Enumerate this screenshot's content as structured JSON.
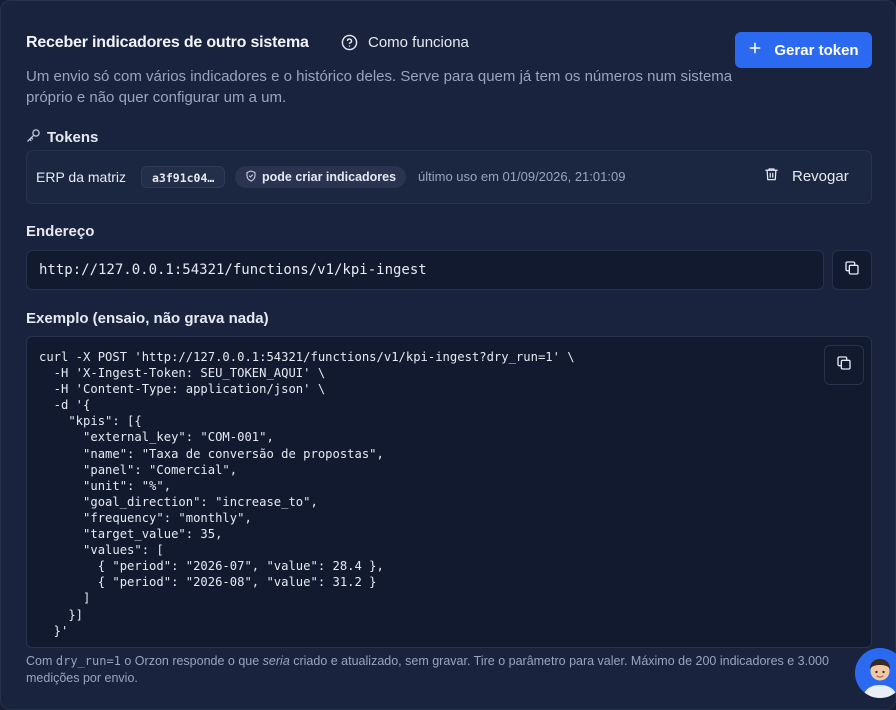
{
  "header": {
    "title": "Receber indicadores de outro sistema",
    "how_it_works": "Como funciona",
    "generate_button": "Gerar token",
    "description": "Um envio só com vários indicadores e o histórico deles. Serve para quem já tem os números num sistema próprio e não quer configurar um a um."
  },
  "tokens": {
    "label": "Tokens",
    "items": [
      {
        "name": "ERP da matriz",
        "code": "a3f91c04…",
        "permission": "pode criar indicadores",
        "last_used": "último uso em 01/09/2026, 21:01:09",
        "revoke_label": "Revogar"
      }
    ]
  },
  "endpoint": {
    "label": "Endereço",
    "url": "http://127.0.0.1:54321/functions/v1/kpi-ingest"
  },
  "example": {
    "label": "Exemplo (ensaio, não grava nada)",
    "code": "curl -X POST 'http://127.0.0.1:54321/functions/v1/kpi-ingest?dry_run=1' \\\n  -H 'X-Ingest-Token: SEU_TOKEN_AQUI' \\\n  -H 'Content-Type: application/json' \\\n  -d '{\n    \"kpis\": [{\n      \"external_key\": \"COM-001\",\n      \"name\": \"Taxa de conversão de propostas\",\n      \"panel\": \"Comercial\",\n      \"unit\": \"%\",\n      \"goal_direction\": \"increase_to\",\n      \"frequency\": \"monthly\",\n      \"target_value\": 35,\n      \"values\": [\n        { \"period\": \"2026-07\", \"value\": 28.4 },\n        { \"period\": \"2026-08\", \"value\": 31.2 }\n      ]\n    }]\n  }'"
  },
  "footer_note": {
    "prefix": "Com ",
    "code": "dry_run=1",
    "middle": " o Orzon responde o que ",
    "emphasis": "seria",
    "suffix": " criado e atualizado, sem gravar. Tire o parâmetro para valer. Máximo de 200 indicadores e 3.000 medições por envio."
  },
  "colors": {
    "background": "#19233d",
    "accent": "#2b6af0",
    "muted_text": "#9aa4bd"
  }
}
